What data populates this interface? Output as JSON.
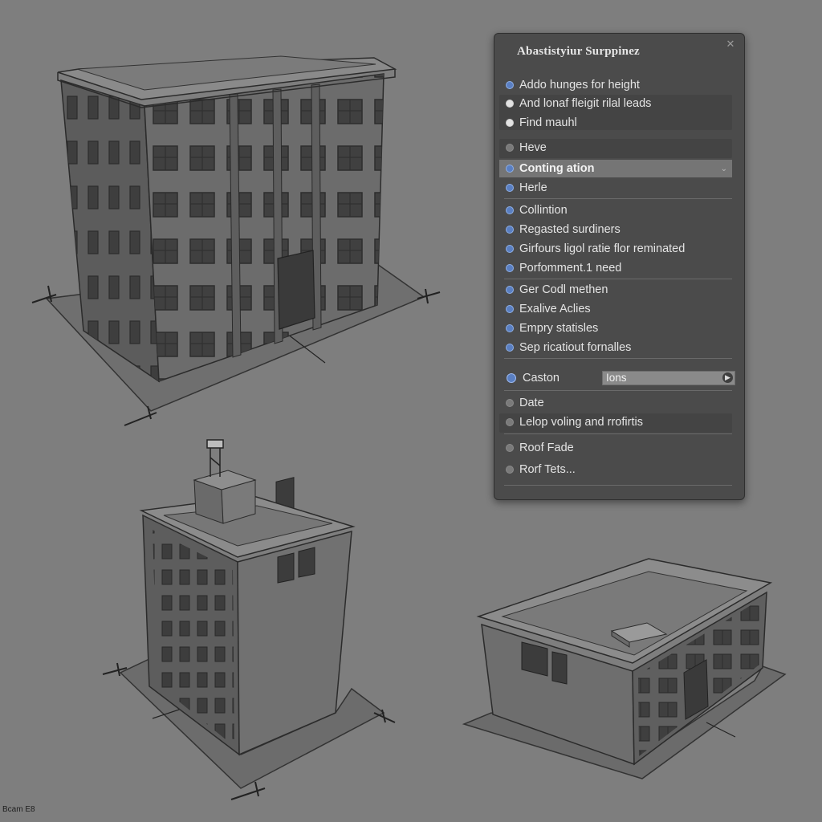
{
  "panel": {
    "title": "Abastistyiur Surppinez",
    "close_icon": "close-icon",
    "items": [
      {
        "label": "Addo hunges for height",
        "icon": "check"
      },
      {
        "label": "And lonaf fleigit rilal leads",
        "icon": "white"
      },
      {
        "label": "Find mauhl",
        "icon": "white"
      },
      {
        "label": "Heve",
        "icon": "gray"
      },
      {
        "label": "Conting ation",
        "icon": "check"
      },
      {
        "label": "Herle",
        "icon": "check"
      },
      {
        "label": "Collintion",
        "icon": "check"
      },
      {
        "label": "Regasted surdiners",
        "icon": "check"
      },
      {
        "label": "Girfours ligol ratie flor reminated",
        "icon": "check"
      },
      {
        "label": "Porfomment.1 need",
        "icon": "check"
      },
      {
        "label": "Ger Codl methen",
        "icon": "check"
      },
      {
        "label": "Exalive Aclies",
        "icon": "check"
      },
      {
        "label": "Empry statisles",
        "icon": "check"
      },
      {
        "label": "Sep ricatiout fornalles",
        "icon": "check"
      },
      {
        "label": "Date",
        "icon": "gray"
      },
      {
        "label": "Lelop voling and rrofirtis",
        "icon": "gray"
      },
      {
        "label": "Roof Fade",
        "icon": "gray"
      },
      {
        "label": "Rorf Tets...",
        "icon": "gray"
      }
    ],
    "field": {
      "label": "Caston",
      "value": "Ions",
      "icon": "info-icon"
    }
  },
  "footer": {
    "text": "Bcam E8"
  },
  "colors": {
    "background": "#7e7e7e",
    "panel": "#4b4b4b",
    "accent": "#5a7fc2",
    "building_front": "#6a6a6a",
    "building_side": "#575757",
    "roof": "#7b7b7b"
  }
}
